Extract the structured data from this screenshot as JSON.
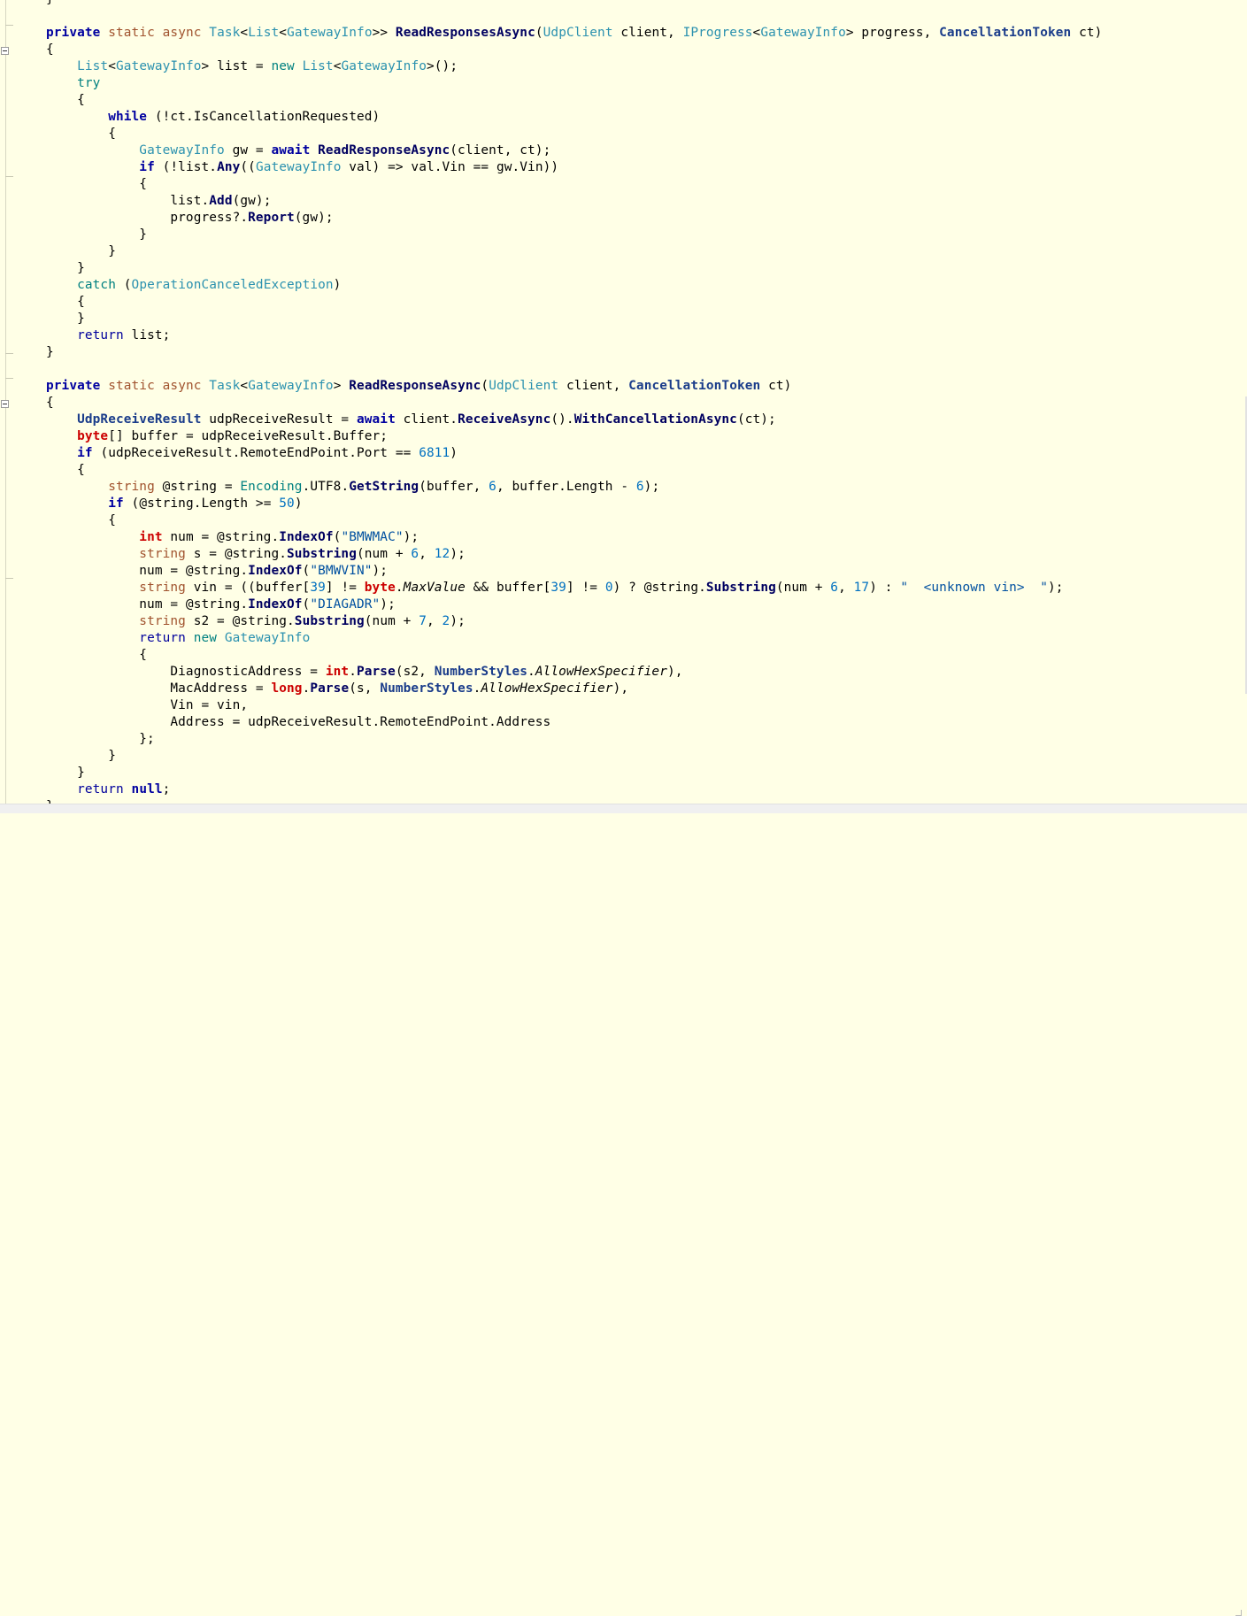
{
  "editor": {
    "lines": [
      [
        {
          "t": "}"
        }
      ],
      [],
      [
        {
          "t": "private",
          "c": "kwb"
        },
        {
          "t": " "
        },
        {
          "t": "static",
          "c": "mod"
        },
        {
          "t": " "
        },
        {
          "t": "async",
          "c": "mod"
        },
        {
          "t": " "
        },
        {
          "t": "Task",
          "c": "typ"
        },
        {
          "t": "<"
        },
        {
          "t": "List",
          "c": "typ"
        },
        {
          "t": "<"
        },
        {
          "t": "GatewayInfo",
          "c": "typ"
        },
        {
          "t": ">> "
        },
        {
          "t": "ReadResponsesAsync",
          "c": "mth"
        },
        {
          "t": "("
        },
        {
          "t": "UdpClient",
          "c": "typ"
        },
        {
          "t": " client, "
        },
        {
          "t": "IProgress",
          "c": "typ"
        },
        {
          "t": "<"
        },
        {
          "t": "GatewayInfo",
          "c": "typ"
        },
        {
          "t": "> progress, "
        },
        {
          "t": "CancellationToken",
          "c": "typb"
        },
        {
          "t": " ct)"
        }
      ],
      [
        {
          "t": "{"
        }
      ],
      [
        {
          "t": "    "
        },
        {
          "t": "List",
          "c": "typ"
        },
        {
          "t": "<"
        },
        {
          "t": "GatewayInfo",
          "c": "typ"
        },
        {
          "t": "> list = "
        },
        {
          "t": "new",
          "c": "teal"
        },
        {
          "t": " "
        },
        {
          "t": "List",
          "c": "typ"
        },
        {
          "t": "<"
        },
        {
          "t": "GatewayInfo",
          "c": "typ"
        },
        {
          "t": ">();"
        }
      ],
      [
        {
          "t": "    "
        },
        {
          "t": "try",
          "c": "teal"
        }
      ],
      [
        {
          "t": "    {"
        }
      ],
      [
        {
          "t": "        "
        },
        {
          "t": "while",
          "c": "kwb"
        },
        {
          "t": " (!ct.IsCancellationRequested)"
        }
      ],
      [
        {
          "t": "        {"
        }
      ],
      [
        {
          "t": "            "
        },
        {
          "t": "GatewayInfo",
          "c": "typ"
        },
        {
          "t": " gw = "
        },
        {
          "t": "await",
          "c": "kwb"
        },
        {
          "t": " "
        },
        {
          "t": "ReadResponseAsync",
          "c": "mth"
        },
        {
          "t": "(client, ct);"
        }
      ],
      [
        {
          "t": "            "
        },
        {
          "t": "if",
          "c": "kwb"
        },
        {
          "t": " (!list."
        },
        {
          "t": "Any",
          "c": "mth"
        },
        {
          "t": "(("
        },
        {
          "t": "GatewayInfo",
          "c": "typ"
        },
        {
          "t": " val) => val.Vin == gw.Vin))"
        }
      ],
      [
        {
          "t": "            {"
        }
      ],
      [
        {
          "t": "                list."
        },
        {
          "t": "Add",
          "c": "mth"
        },
        {
          "t": "(gw);"
        }
      ],
      [
        {
          "t": "                progress?."
        },
        {
          "t": "Report",
          "c": "mth"
        },
        {
          "t": "(gw);"
        }
      ],
      [
        {
          "t": "            }"
        }
      ],
      [
        {
          "t": "        }"
        }
      ],
      [
        {
          "t": "    }"
        }
      ],
      [
        {
          "t": "    "
        },
        {
          "t": "catch",
          "c": "teal"
        },
        {
          "t": " ("
        },
        {
          "t": "OperationCanceledException",
          "c": "typ"
        },
        {
          "t": ")"
        }
      ],
      [
        {
          "t": "    {"
        }
      ],
      [
        {
          "t": "    }"
        }
      ],
      [
        {
          "t": "    "
        },
        {
          "t": "return",
          "c": "kwd"
        },
        {
          "t": " list;"
        }
      ],
      [
        {
          "t": "}"
        }
      ],
      [],
      [
        {
          "t": "private",
          "c": "kwb"
        },
        {
          "t": " "
        },
        {
          "t": "static",
          "c": "mod"
        },
        {
          "t": " "
        },
        {
          "t": "async",
          "c": "mod"
        },
        {
          "t": " "
        },
        {
          "t": "Task",
          "c": "typ"
        },
        {
          "t": "<"
        },
        {
          "t": "GatewayInfo",
          "c": "typ"
        },
        {
          "t": "> "
        },
        {
          "t": "ReadResponseAsync",
          "c": "mth"
        },
        {
          "t": "("
        },
        {
          "t": "UdpClient",
          "c": "typ"
        },
        {
          "t": " client, "
        },
        {
          "t": "CancellationToken",
          "c": "typb"
        },
        {
          "t": " ct)"
        }
      ],
      [
        {
          "t": "{"
        }
      ],
      [
        {
          "t": "    "
        },
        {
          "t": "UdpReceiveResult",
          "c": "typb"
        },
        {
          "t": " udpReceiveResult = "
        },
        {
          "t": "await",
          "c": "kwb"
        },
        {
          "t": " client."
        },
        {
          "t": "ReceiveAsync",
          "c": "mth"
        },
        {
          "t": "()."
        },
        {
          "t": "WithCancellationAsync",
          "c": "mth"
        },
        {
          "t": "(ct);"
        }
      ],
      [
        {
          "t": "    "
        },
        {
          "t": "byte",
          "c": "red"
        },
        {
          "t": "[] buffer = udpReceiveResult.Buffer;"
        }
      ],
      [
        {
          "t": "    "
        },
        {
          "t": "if",
          "c": "kwb"
        },
        {
          "t": " (udpReceiveResult.RemoteEndPoint.Port == "
        },
        {
          "t": "6811",
          "c": "num"
        },
        {
          "t": ")"
        }
      ],
      [
        {
          "t": "    {"
        }
      ],
      [
        {
          "t": "        "
        },
        {
          "t": "string",
          "c": "mod"
        },
        {
          "t": " @string = "
        },
        {
          "t": "Encoding",
          "c": "teal"
        },
        {
          "t": ".UTF8."
        },
        {
          "t": "GetString",
          "c": "mth"
        },
        {
          "t": "(buffer, "
        },
        {
          "t": "6",
          "c": "num"
        },
        {
          "t": ", buffer.Length - "
        },
        {
          "t": "6",
          "c": "num"
        },
        {
          "t": ");"
        }
      ],
      [
        {
          "t": "        "
        },
        {
          "t": "if",
          "c": "kwb"
        },
        {
          "t": " (@string.Length >= "
        },
        {
          "t": "50",
          "c": "num"
        },
        {
          "t": ")"
        }
      ],
      [
        {
          "t": "        {"
        }
      ],
      [
        {
          "t": "            "
        },
        {
          "t": "int",
          "c": "red"
        },
        {
          "t": " num = @string."
        },
        {
          "t": "IndexOf",
          "c": "mth"
        },
        {
          "t": "("
        },
        {
          "t": "\"BMWMAC\"",
          "c": "str"
        },
        {
          "t": ");"
        }
      ],
      [
        {
          "t": "            "
        },
        {
          "t": "string",
          "c": "mod"
        },
        {
          "t": " s = @string."
        },
        {
          "t": "Substring",
          "c": "mth"
        },
        {
          "t": "(num + "
        },
        {
          "t": "6",
          "c": "num"
        },
        {
          "t": ", "
        },
        {
          "t": "12",
          "c": "num"
        },
        {
          "t": ");"
        }
      ],
      [
        {
          "t": "            num = @string."
        },
        {
          "t": "IndexOf",
          "c": "mth"
        },
        {
          "t": "("
        },
        {
          "t": "\"BMWVIN\"",
          "c": "str"
        },
        {
          "t": ");"
        }
      ],
      [
        {
          "t": "            "
        },
        {
          "t": "string",
          "c": "mod"
        },
        {
          "t": " vin = ((buffer["
        },
        {
          "t": "39",
          "c": "num"
        },
        {
          "t": "] != "
        },
        {
          "t": "byte",
          "c": "red"
        },
        {
          "t": "."
        },
        {
          "t": "MaxValue",
          "c": "ital"
        },
        {
          "t": " && buffer["
        },
        {
          "t": "39",
          "c": "num"
        },
        {
          "t": "] != "
        },
        {
          "t": "0",
          "c": "num"
        },
        {
          "t": ") ? @string."
        },
        {
          "t": "Substring",
          "c": "mth"
        },
        {
          "t": "(num + "
        },
        {
          "t": "6",
          "c": "num"
        },
        {
          "t": ", "
        },
        {
          "t": "17",
          "c": "num"
        },
        {
          "t": ") : "
        },
        {
          "t": "\"  <unknown vin>  \"",
          "c": "str"
        },
        {
          "t": ");"
        }
      ],
      [
        {
          "t": "            num = @string."
        },
        {
          "t": "IndexOf",
          "c": "mth"
        },
        {
          "t": "("
        },
        {
          "t": "\"DIAGADR\"",
          "c": "str"
        },
        {
          "t": ");"
        }
      ],
      [
        {
          "t": "            "
        },
        {
          "t": "string",
          "c": "mod"
        },
        {
          "t": " s2 = @string."
        },
        {
          "t": "Substring",
          "c": "mth"
        },
        {
          "t": "(num + "
        },
        {
          "t": "7",
          "c": "num"
        },
        {
          "t": ", "
        },
        {
          "t": "2",
          "c": "num"
        },
        {
          "t": ");"
        }
      ],
      [
        {
          "t": "            "
        },
        {
          "t": "return",
          "c": "kwd"
        },
        {
          "t": " "
        },
        {
          "t": "new",
          "c": "teal"
        },
        {
          "t": " "
        },
        {
          "t": "GatewayInfo",
          "c": "typ"
        }
      ],
      [
        {
          "t": "            {"
        }
      ],
      [
        {
          "t": "                DiagnosticAddress = "
        },
        {
          "t": "int",
          "c": "red"
        },
        {
          "t": "."
        },
        {
          "t": "Parse",
          "c": "mth"
        },
        {
          "t": "(s2, "
        },
        {
          "t": "NumberStyles",
          "c": "typb"
        },
        {
          "t": "."
        },
        {
          "t": "AllowHexSpecifier",
          "c": "ital"
        },
        {
          "t": "),"
        }
      ],
      [
        {
          "t": "                MacAddress = "
        },
        {
          "t": "long",
          "c": "red"
        },
        {
          "t": "."
        },
        {
          "t": "Parse",
          "c": "mth"
        },
        {
          "t": "(s, "
        },
        {
          "t": "NumberStyles",
          "c": "typb"
        },
        {
          "t": "."
        },
        {
          "t": "AllowHexSpecifier",
          "c": "ital"
        },
        {
          "t": "),"
        }
      ],
      [
        {
          "t": "                Vin = vin,"
        }
      ],
      [
        {
          "t": "                Address = udpReceiveResult.RemoteEndPoint.Address"
        }
      ],
      [
        {
          "t": "            };"
        }
      ],
      [
        {
          "t": "        }"
        }
      ],
      [
        {
          "t": "    }"
        }
      ],
      [
        {
          "t": "    "
        },
        {
          "t": "return",
          "c": "kwd"
        },
        {
          "t": " "
        },
        {
          "t": "null",
          "c": "kwb"
        },
        {
          "t": ";"
        }
      ],
      [
        {
          "t": "}"
        }
      ]
    ]
  }
}
